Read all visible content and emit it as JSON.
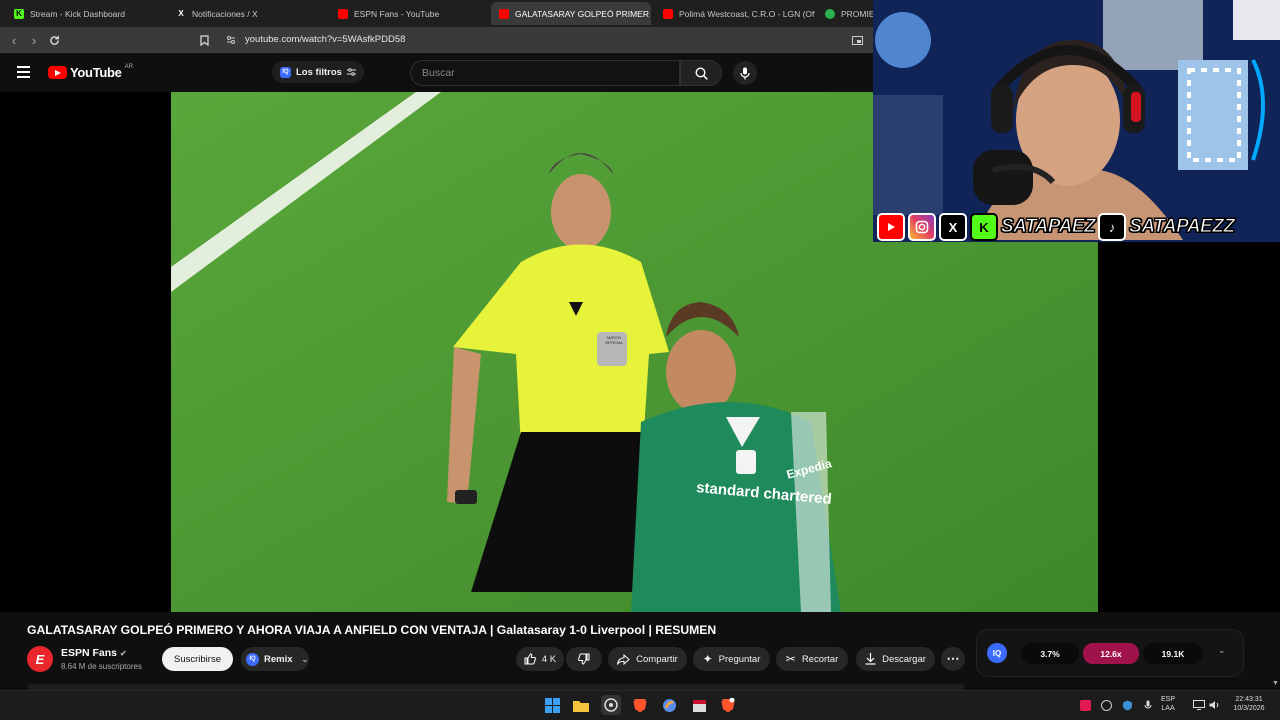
{
  "browser": {
    "tabs": [
      {
        "label": "Stream - Kick Dashboard",
        "icon": "kick-icon",
        "color": "#53fc18"
      },
      {
        "label": "Notificaciones / X",
        "icon": "x-icon",
        "color": "#ffffff"
      },
      {
        "label": "ESPN Fans - YouTube",
        "icon": "youtube-icon",
        "color": "#ff0000"
      },
      {
        "label": "GALATASARAY GOLPEÓ PRIMER",
        "icon": "youtube-icon",
        "color": "#ff0000",
        "active": true
      },
      {
        "label": "Polimá Westcoast, C.R.O - LGN (Offic",
        "icon": "youtube-icon",
        "color": "#ff0000"
      },
      {
        "label": "PROMIED",
        "icon": "shield-icon",
        "color": "#2bb24c"
      }
    ],
    "url": "youtube.com/watch?v=5WAsfkPDD58"
  },
  "youtube": {
    "logo_text": "YouTube",
    "country_code": "AR",
    "filters_label": "Los filtros",
    "search_placeholder": "Buscar"
  },
  "webcam": {
    "handle_kick": "SATAPAEZ",
    "handle_tiktok": "SATAPAEZZ",
    "referee_badge": "MATCH OFFICIAL",
    "sponsor": "standard chartered",
    "sponsor_sleeve": "Expedia"
  },
  "video": {
    "title": "GALATASARAY GOLPEÓ PRIMERO Y AHORA VIAJA A ANFIELD CON VENTAJA | Galatasaray 1-0 Liverpool | RESUMEN",
    "channel": "ESPN Fans",
    "subscribers": "8.64 M de suscriptores",
    "subscribe_label": "Suscribirse",
    "remix_label": "Remix",
    "likes": "4 K",
    "share_label": "Compartir",
    "ask_label": "Preguntar",
    "clip_label": "Recortar",
    "download_label": "Descargar"
  },
  "iq_panel": {
    "badge": "IQ",
    "stat1": "3.7%",
    "stat2": "12.6x",
    "stat3": "19.1K",
    "highlight_color": "#a0124a"
  },
  "taskbar": {
    "lang_top": "ESP",
    "lang_bottom": "LAA",
    "time": "22:43:31",
    "date": "10/3/2026"
  }
}
